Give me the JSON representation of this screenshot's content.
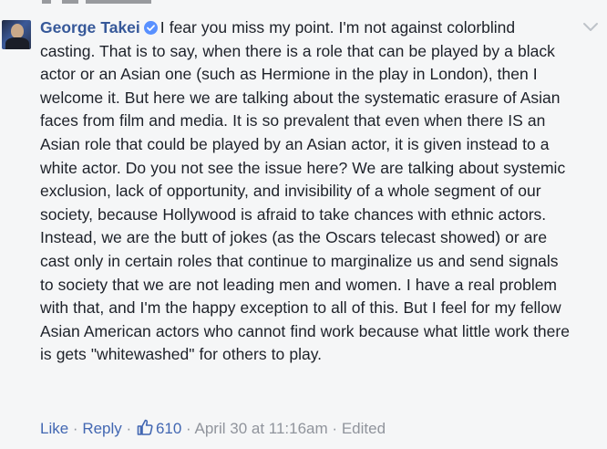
{
  "comment": {
    "author": "George Takei",
    "text": "I fear you miss my point. I'm not against colorblind casting. That is to say, when there is a role that can be played by a black actor or an Asian one (such as Hermione in the play in London), then I welcome it. But here we are talking about the systematic erasure of Asian faces from film and media. It is so prevalent that even when there IS an Asian role that could be played by an Asian actor, it is given instead to a white actor. Do you not see the issue here? We are talking about systemic exclusion, lack of opportunity, and invisibility of a whole segment of our society, because Hollywood is afraid to take chances with ethnic actors. Instead, we are the butt of jokes (as the Oscars telecast showed) or are cast only in certain roles that continue to marginalize us and send signals to society that we are not leading men and women. I have a real problem with that, and I'm the happy exception to all of this. But I feel for my fellow Asian American actors who cannot find work because what little work there is gets \"whitewashed\" for others to play."
  },
  "actions": {
    "like_label": "Like",
    "separator": "·",
    "reply_label": "Reply",
    "like_count": "610",
    "timestamp": "April 30 at 11:16am",
    "edited_label": "Edited"
  },
  "icons": {
    "verified": "verified-badge-icon",
    "like": "thumbs-up-icon",
    "menu": "chevron-down-icon"
  },
  "colors": {
    "author": "#365899",
    "link": "#4267b2",
    "meta": "#90949c",
    "verified": "#5890ff",
    "background": "#f5f6f7"
  }
}
